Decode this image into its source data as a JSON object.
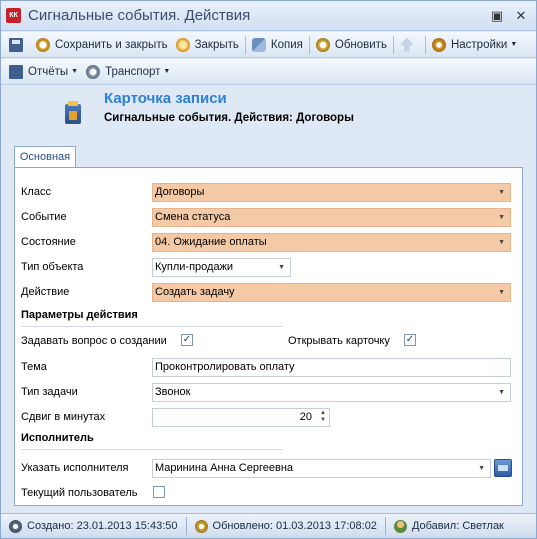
{
  "window": {
    "app_icon_text": "КК",
    "title": "Сигнальные события. Действия",
    "pin_glyph": "▣",
    "close_glyph": "✕"
  },
  "toolbar": {
    "save_close_label": "Сохранить и закрыть",
    "close_label": "Закрыть",
    "copy_label": "Копия",
    "refresh_label": "Обновить",
    "settings_label": "Настройки"
  },
  "toolbar2": {
    "reports_label": "Отчёты",
    "transport_label": "Транспорт"
  },
  "header": {
    "title": "Карточка записи",
    "subtitle": "Сигнальные события. Действия: Договоры"
  },
  "tabs": [
    {
      "label": "Основная",
      "active": true
    }
  ],
  "form": {
    "class_label": "Класс",
    "class_value": "Договоры",
    "event_label": "Событие",
    "event_value": "Смена статуса",
    "state_label": "Состояние",
    "state_value": "04. Ожидание оплаты",
    "object_type_label": "Тип объекта",
    "object_type_value": "Купли-продажи",
    "action_label": "Действие",
    "action_value": "Создать задачу",
    "params_section": "Параметры действия",
    "ask_on_create_label": "Задавать вопрос о создании",
    "ask_on_create_checked": true,
    "open_card_label": "Открывать карточку",
    "open_card_checked": true,
    "subject_label": "Тема",
    "subject_value": "Проконтролировать оплату",
    "task_type_label": "Тип задачи",
    "task_type_value": "Звонок",
    "shift_label": "Сдвиг в минутах",
    "shift_value": "20",
    "executor_section": "Исполнитель",
    "assignee_label": "Указать исполнителя",
    "assignee_value": "Маринина Анна Сергеевна",
    "current_user_label": "Текущий пользователь",
    "current_user_checked": false
  },
  "status": {
    "created": "Создано: 23.01.2013 15:43:50",
    "updated": "Обновлено: 01.03.2013 17:08:02",
    "added_by": "Добавил: Светлак"
  },
  "colors": {
    "required_field": "#f4c9a6",
    "accent_title": "#2f80d0",
    "window_bg": "#dfe9f5"
  }
}
